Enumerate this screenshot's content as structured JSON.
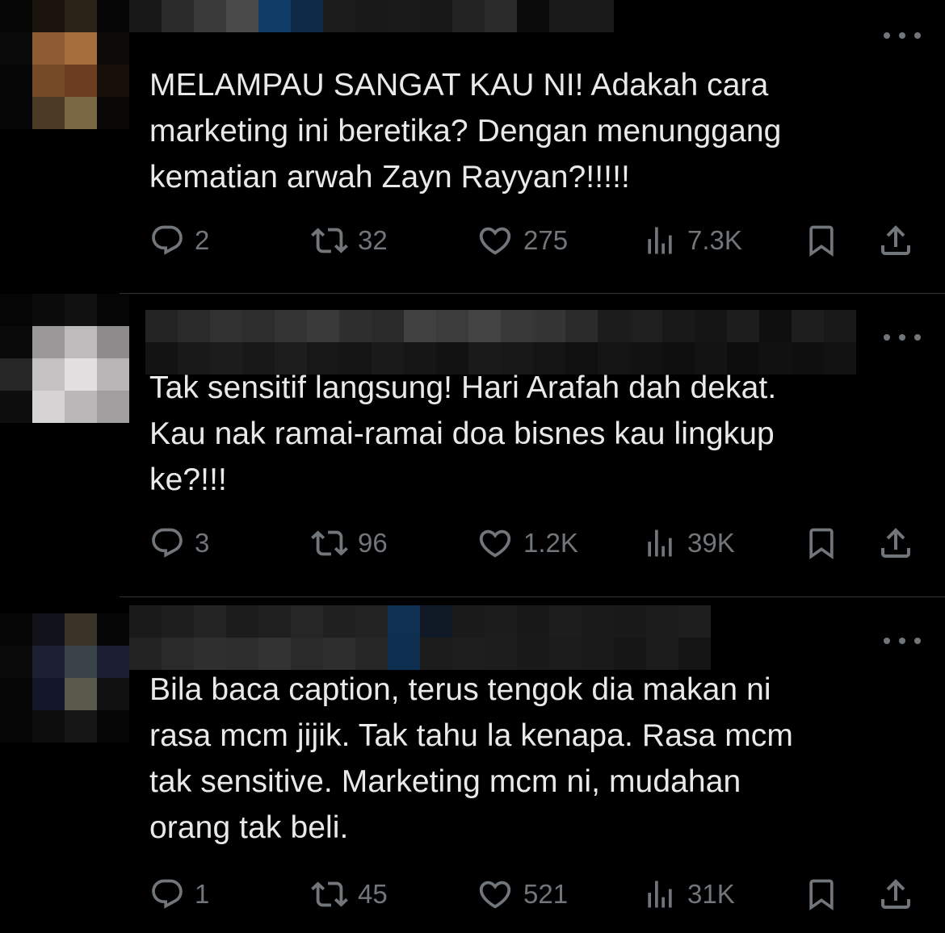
{
  "theme": {
    "background": "#000000",
    "text": "#e7e9ea",
    "muted": "#71767b",
    "divider": "#2f3336"
  },
  "replies": [
    {
      "text": "MELAMPAU SANGAT KAU NI! Adakah cara\nmarketing ini beretika? Dengan menunggang\nkematian arwah Zayn Rayyan?!!!!!",
      "replies": "2",
      "reposts": "32",
      "likes": "275",
      "views": "7.3K"
    },
    {
      "text": "Tak sensitif langsung! Hari Arafah dah dekat.\nKau nak ramai-ramai doa bisnes kau lingkup\nke?!!!",
      "replies": "3",
      "reposts": "96",
      "likes": "1.2K",
      "views": "39K"
    },
    {
      "text": "Bila baca caption, terus tengok dia makan ni\nrasa mcm jijik. Tak tahu la kenapa. Rasa mcm\ntak sensitive. Marketing mcm ni, mudahan\norang tak beli.",
      "replies": "1",
      "reposts": "45",
      "likes": "521",
      "views": "31K"
    }
  ],
  "icons": {
    "reply": "speech-bubble-icon",
    "repost": "repost-arrows-icon",
    "like": "heart-icon",
    "views": "bar-chart-icon",
    "bookmark": "bookmark-icon",
    "share": "share-upload-icon",
    "more": "more-dots-icon"
  }
}
